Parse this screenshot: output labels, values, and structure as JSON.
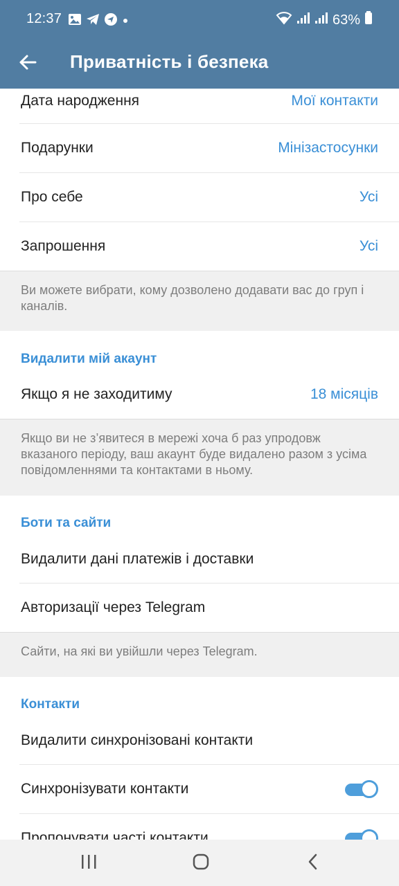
{
  "status_bar": {
    "time": "12:37",
    "battery": "63%",
    "icons": [
      "gallery-icon",
      "telegram-icon",
      "navigation-icon",
      "dot-icon"
    ],
    "right_icons": [
      "wifi-icon",
      "signal-icon",
      "signal-icon",
      "battery-icon"
    ]
  },
  "app_bar": {
    "title": "Приватність і безпека",
    "back_icon": "arrow-left-icon"
  },
  "privacy_rows": [
    {
      "label": "Дата народження",
      "value": "Мої контакти"
    },
    {
      "label": "Подарунки",
      "value": "Мінізастосунки"
    },
    {
      "label": "Про себе",
      "value": "Усі"
    },
    {
      "label": "Запрошення",
      "value": "Усі"
    }
  ],
  "invites_info": "Ви можете вибрати, кому дозволено додавати вас до груп і каналів.",
  "delete_account": {
    "header": "Видалити мій акаунт",
    "row_label": "Якщо я не заходитиму",
    "row_value": "18 місяців",
    "info": "Якщо ви не з’явитеся в мережі хоча б раз упродовж вказаного періоду, ваш акаунт буде видалено разом з усіма повідомленнями та контактами в ньому."
  },
  "bots": {
    "header": "Боти та сайти",
    "rows": [
      "Видалити дані платежів і доставки",
      "Авторизації через Telegram"
    ],
    "info": "Сайти, на які ви увійшли через Telegram."
  },
  "contacts": {
    "header": "Контакти",
    "delete_synced": "Видалити синхронізовані контакти",
    "sync_label": "Синхронізувати контакти",
    "sync_on": true,
    "frequent_label": "Пропонувати часті контакти",
    "frequent_on": true
  },
  "colors": {
    "app_bar": "#517da2",
    "accent": "#3a8fd6",
    "info_bg": "#f0f0f0"
  },
  "nav_bar": [
    "recents-icon",
    "home-icon",
    "back-icon"
  ]
}
